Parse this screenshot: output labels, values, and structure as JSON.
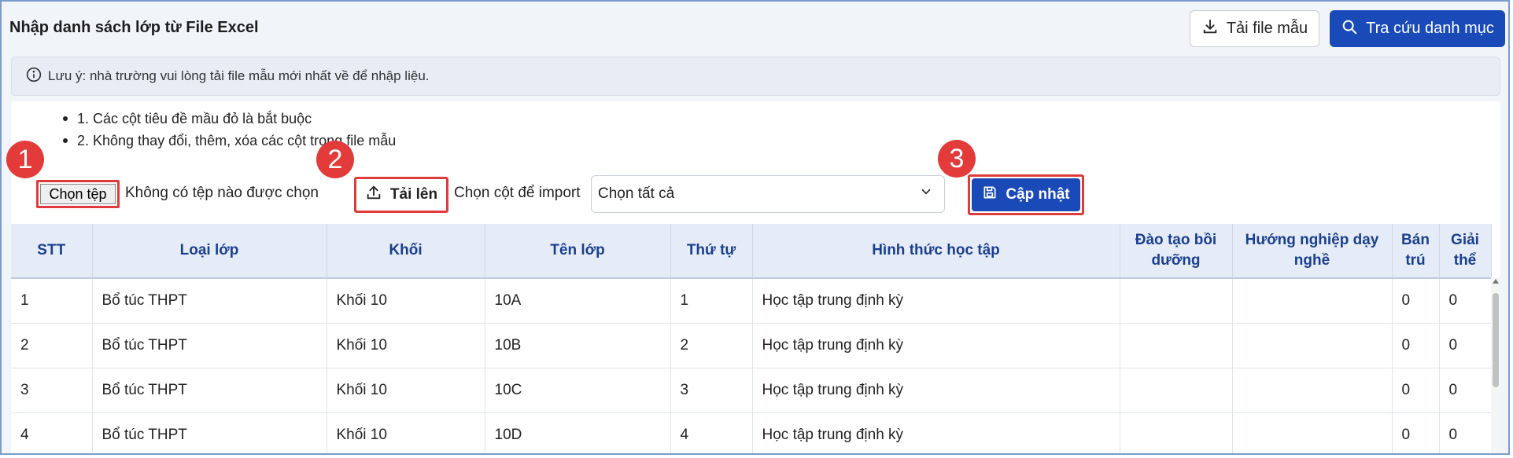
{
  "header": {
    "title": "Nhập danh sách lớp từ File Excel",
    "download_template_label": "Tải file mẫu",
    "lookup_label": "Tra cứu danh mục"
  },
  "note": {
    "text": "Lưu ý: nhà trường vui lòng tải file mẫu mới nhất về để nhập liệu."
  },
  "rules": [
    "1. Các cột tiêu đề mầu đỏ là bắt buộc",
    "2. Không thay đổi, thêm, xóa các cột trong file mẫu"
  ],
  "badges": [
    "1",
    "2",
    "3"
  ],
  "upload": {
    "choose_file_label": "Chọn tệp",
    "file_status": "Không có tệp nào được chọn",
    "upload_label": "Tải lên",
    "column_label": "Chọn cột để import",
    "column_select_value": "Chọn tất cả",
    "update_label": "Cập nhật"
  },
  "table": {
    "headers": [
      "STT",
      "Loại lớp",
      "Khối",
      "Tên lớp",
      "Thứ tự",
      "Hình thức học tập",
      "Đào tạo bồi dưỡng",
      "Hướng nghiệp dạy nghề",
      "Bán trú",
      "Giải thể"
    ],
    "rows": [
      [
        "1",
        "Bổ túc THPT",
        "Khối 10",
        "10A",
        "1",
        "Học tập trung định kỳ",
        "",
        "",
        "0",
        "0"
      ],
      [
        "2",
        "Bổ túc THPT",
        "Khối 10",
        "10B",
        "2",
        "Học tập trung định kỳ",
        "",
        "",
        "0",
        "0"
      ],
      [
        "3",
        "Bổ túc THPT",
        "Khối 10",
        "10C",
        "3",
        "Học tập trung định kỳ",
        "",
        "",
        "0",
        "0"
      ],
      [
        "4",
        "Bổ túc THPT",
        "Khối 10",
        "10D",
        "4",
        "Học tập trung định kỳ",
        "",
        "",
        "0",
        "0"
      ]
    ]
  },
  "colors": {
    "primary": "#1a49b8",
    "highlight": "#e03b3b",
    "header_text": "#1a3f8f"
  }
}
